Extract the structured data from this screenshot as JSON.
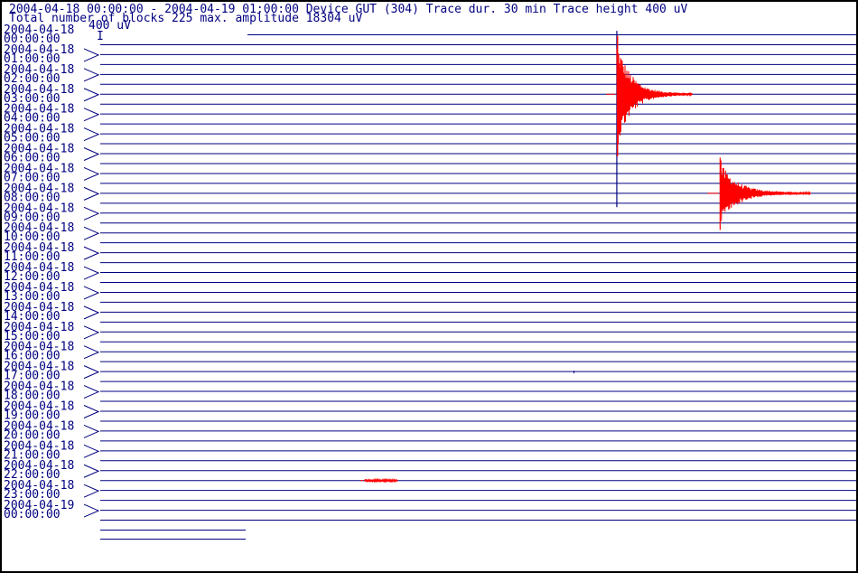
{
  "header": {
    "line1": "2004-04-18 00:00:00 - 2004-04-19 01:00:00  Device  GUT (304)  Trace dur. 30 min  Trace height 400 uV",
    "line2": "Total number of blocks 225 max. amplitude 18304 uV"
  },
  "colors": {
    "trace": "#000080",
    "event": "#ff0000",
    "frame": "#000000",
    "background": "#ffffff"
  },
  "chart_data": {
    "type": "line",
    "title": "2004-04-18 00:00:00 - 2004-04-19 01:00:00  Device  GUT (304)  Trace dur. 30 min  Trace height 400 uV",
    "subtitle": "Total number of blocks 225 max. amplitude 18304 uV",
    "scale_label": "400 uV",
    "scale_bar_label": "I",
    "trace_duration_min": 30,
    "trace_height_uV": 400,
    "max_amplitude_uV": 18304,
    "time_labels": [
      {
        "date": "2004-04-18",
        "time": "00:00:00"
      },
      {
        "date": "2004-04-18",
        "time": "01:00:00"
      },
      {
        "date": "2004-04-18",
        "time": "02:00:00"
      },
      {
        "date": "2004-04-18",
        "time": "03:00:00"
      },
      {
        "date": "2004-04-18",
        "time": "04:00:00"
      },
      {
        "date": "2004-04-18",
        "time": "05:00:00"
      },
      {
        "date": "2004-04-18",
        "time": "06:00:00"
      },
      {
        "date": "2004-04-18",
        "time": "07:00:00"
      },
      {
        "date": "2004-04-18",
        "time": "08:00:00"
      },
      {
        "date": "2004-04-18",
        "time": "09:00:00"
      },
      {
        "date": "2004-04-18",
        "time": "10:00:00"
      },
      {
        "date": "2004-04-18",
        "time": "11:00:00"
      },
      {
        "date": "2004-04-18",
        "time": "12:00:00"
      },
      {
        "date": "2004-04-18",
        "time": "13:00:00"
      },
      {
        "date": "2004-04-18",
        "time": "14:00:00"
      },
      {
        "date": "2004-04-18",
        "time": "15:00:00"
      },
      {
        "date": "2004-04-18",
        "time": "16:00:00"
      },
      {
        "date": "2004-04-18",
        "time": "17:00:00"
      },
      {
        "date": "2004-04-18",
        "time": "18:00:00"
      },
      {
        "date": "2004-04-18",
        "time": "19:00:00"
      },
      {
        "date": "2004-04-18",
        "time": "20:00:00"
      },
      {
        "date": "2004-04-18",
        "time": "21:00:00"
      },
      {
        "date": "2004-04-18",
        "time": "22:00:00"
      },
      {
        "date": "2004-04-18",
        "time": "23:00:00"
      },
      {
        "date": "2004-04-19",
        "time": "00:00:00"
      }
    ],
    "trace_count": 50,
    "events": [
      {
        "trace": 6,
        "minute": 20.5,
        "peak_up_traces": 6.4,
        "peak_down_traces": 11.4,
        "duration_min": 3.0
      },
      {
        "trace": 16,
        "minute": 24.6,
        "peak_up_traces": 3.6,
        "peak_down_traces": 3.7,
        "duration_min": 3.6
      },
      {
        "trace": 45,
        "minute": 10.5,
        "peak_up_traces": 0.08,
        "peak_down_traces": 0.08,
        "duration_min": 1.3
      }
    ],
    "minor_spikes": [
      {
        "trace": 32,
        "minute": 30.1
      },
      {
        "trace": 34,
        "minute": 18.8
      }
    ]
  }
}
